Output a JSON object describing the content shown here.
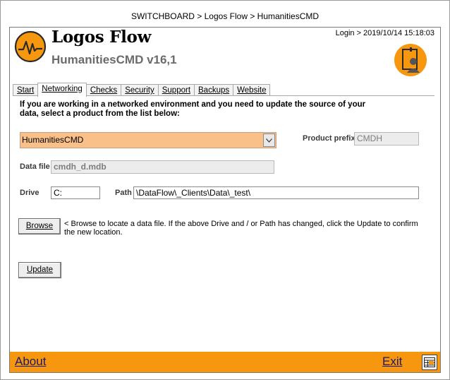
{
  "window": {
    "title": "SWITCHBOARD > Logos Flow > HumanitiesCMD"
  },
  "header": {
    "app_title": "Logos Flow",
    "app_subtitle": "HumanitiesCMD v16,1",
    "login_info": "Login > 2019/10/14 15:18:03",
    "logo_icon": "waveform-logo-icon",
    "user_icon": "user-badge-icon"
  },
  "tabs": [
    {
      "label": "Start",
      "active": false
    },
    {
      "label": "Networking",
      "active": true
    },
    {
      "label": "Checks",
      "active": false
    },
    {
      "label": "Security",
      "active": false
    },
    {
      "label": "Support",
      "active": false
    },
    {
      "label": "Backups",
      "active": false
    },
    {
      "label": "Website",
      "active": false
    }
  ],
  "networking": {
    "intro": "If you are working in a networked environment and you need to update the source of your data, select a product from the list below:",
    "product_select": {
      "value": "HumanitiesCMD"
    },
    "product_prefix": {
      "label": "Product prefix",
      "value": "CMDH"
    },
    "data_file": {
      "label": "Data file",
      "value": "cmdh_d.mdb"
    },
    "drive": {
      "label": "Drive",
      "value": "C:"
    },
    "path": {
      "label": "Path",
      "value": "\\DataFlow\\_Clients\\Data\\_test\\"
    },
    "browse_button": "Browse",
    "browse_hint": "<  Browse to locate a data file. If the above Drive and / or Path has changed, click the Update to confirm the new location.",
    "update_button": "Update"
  },
  "footer": {
    "about_label": "About",
    "exit_label": "Exit",
    "grid_icon": "table-icon"
  },
  "colors": {
    "accent_orange": "#f7970f",
    "select_background": "#f9c089",
    "link_blue": "#1a1a6e"
  }
}
